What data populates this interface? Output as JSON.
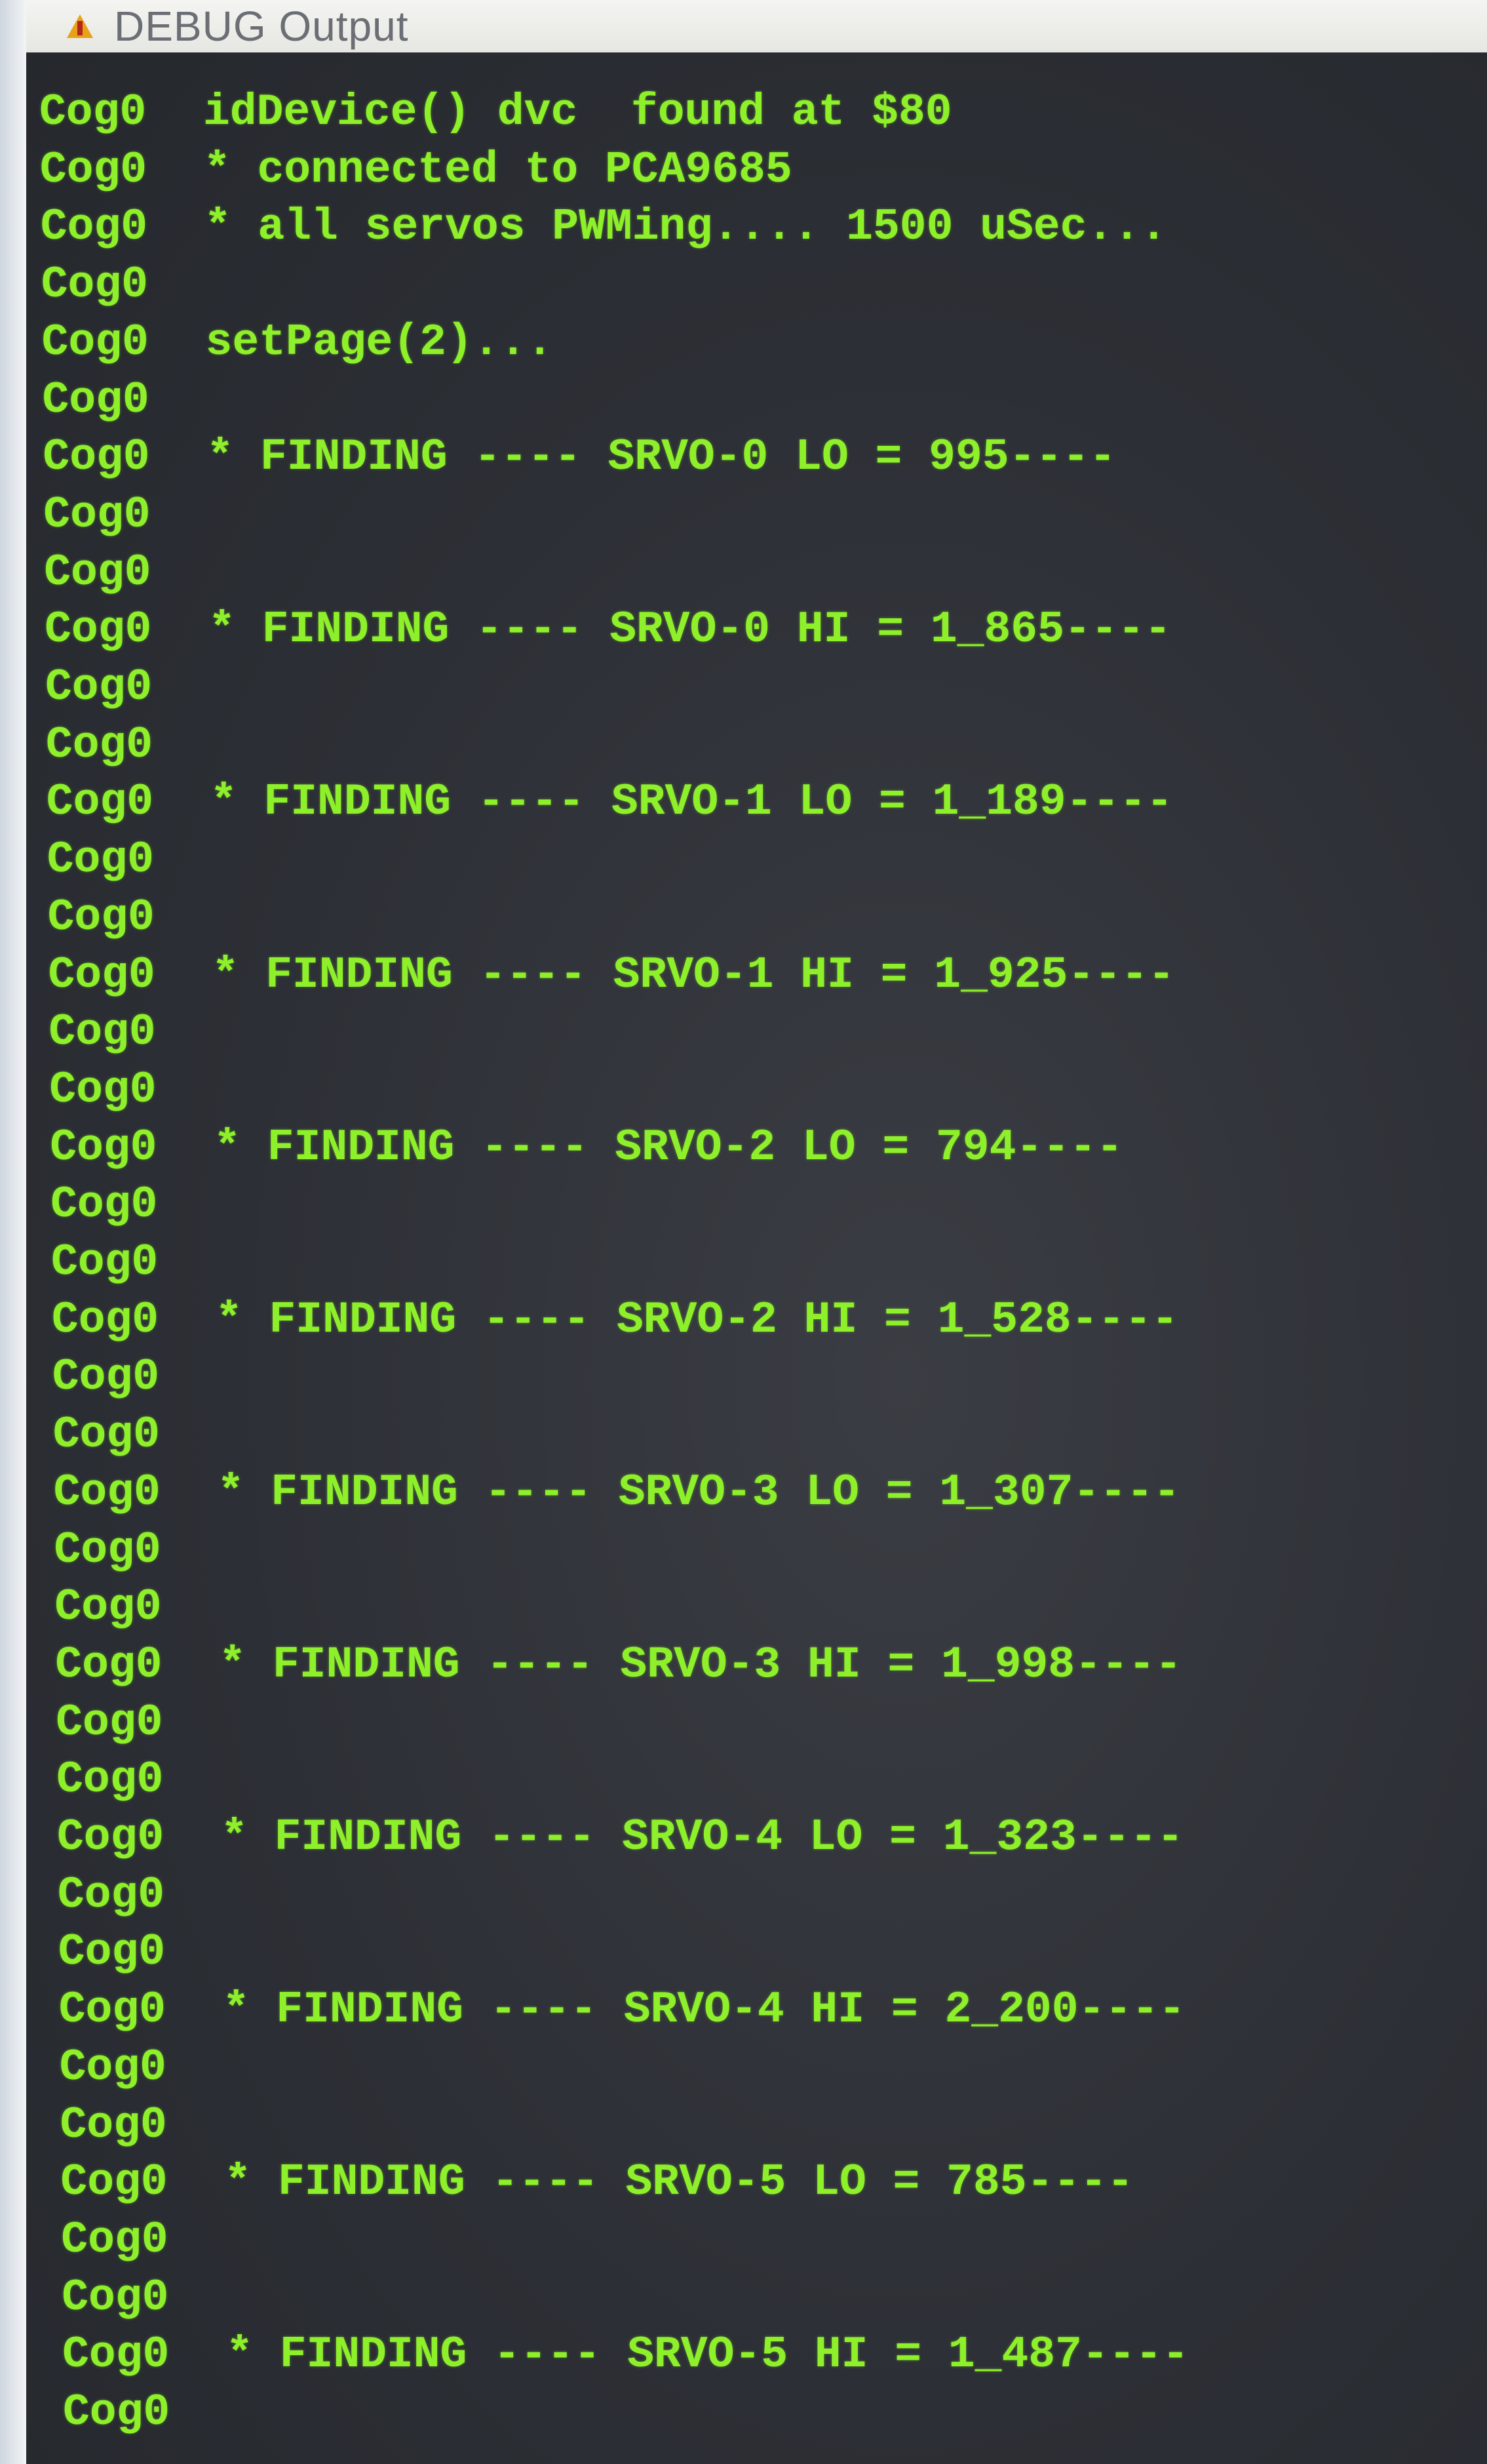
{
  "window": {
    "title": "DEBUG Output",
    "icon": "warning-app-icon"
  },
  "colors": {
    "text": "#8ef02a",
    "background": "#2e3138"
  },
  "lines": [
    {
      "cog": "Cog0",
      "text": "idDevice() dvc  found at $80"
    },
    {
      "cog": "Cog0",
      "text": "* connected to PCA9685"
    },
    {
      "cog": "Cog0",
      "text": "* all servos PWMing.... 1500 uSec..."
    },
    {
      "cog": "Cog0",
      "text": ""
    },
    {
      "cog": "Cog0",
      "text": "setPage(2)..."
    },
    {
      "cog": "Cog0",
      "text": ""
    },
    {
      "cog": "Cog0",
      "text": "* FINDING ---- SRVO-0 LO = 995----"
    },
    {
      "cog": "Cog0",
      "text": ""
    },
    {
      "cog": "Cog0",
      "text": ""
    },
    {
      "cog": "Cog0",
      "text": "* FINDING ---- SRVO-0 HI = 1_865----"
    },
    {
      "cog": "Cog0",
      "text": ""
    },
    {
      "cog": "Cog0",
      "text": ""
    },
    {
      "cog": "Cog0",
      "text": "* FINDING ---- SRVO-1 LO = 1_189----"
    },
    {
      "cog": "Cog0",
      "text": ""
    },
    {
      "cog": "Cog0",
      "text": ""
    },
    {
      "cog": "Cog0",
      "text": "* FINDING ---- SRVO-1 HI = 1_925----"
    },
    {
      "cog": "Cog0",
      "text": ""
    },
    {
      "cog": "Cog0",
      "text": ""
    },
    {
      "cog": "Cog0",
      "text": "* FINDING ---- SRVO-2 LO = 794----"
    },
    {
      "cog": "Cog0",
      "text": ""
    },
    {
      "cog": "Cog0",
      "text": ""
    },
    {
      "cog": "Cog0",
      "text": "* FINDING ---- SRVO-2 HI = 1_528----"
    },
    {
      "cog": "Cog0",
      "text": ""
    },
    {
      "cog": "Cog0",
      "text": ""
    },
    {
      "cog": "Cog0",
      "text": "* FINDING ---- SRVO-3 LO = 1_307----"
    },
    {
      "cog": "Cog0",
      "text": ""
    },
    {
      "cog": "Cog0",
      "text": ""
    },
    {
      "cog": "Cog0",
      "text": "* FINDING ---- SRVO-3 HI = 1_998----"
    },
    {
      "cog": "Cog0",
      "text": ""
    },
    {
      "cog": "Cog0",
      "text": ""
    },
    {
      "cog": "Cog0",
      "text": "* FINDING ---- SRVO-4 LO = 1_323----"
    },
    {
      "cog": "Cog0",
      "text": ""
    },
    {
      "cog": "Cog0",
      "text": ""
    },
    {
      "cog": "Cog0",
      "text": "* FINDING ---- SRVO-4 HI = 2_200----"
    },
    {
      "cog": "Cog0",
      "text": ""
    },
    {
      "cog": "Cog0",
      "text": ""
    },
    {
      "cog": "Cog0",
      "text": "* FINDING ---- SRVO-5 LO = 785----"
    },
    {
      "cog": "Cog0",
      "text": ""
    },
    {
      "cog": "Cog0",
      "text": ""
    },
    {
      "cog": "Cog0",
      "text": "* FINDING ---- SRVO-5 HI = 1_487----"
    },
    {
      "cog": "Cog0",
      "text": ""
    }
  ]
}
